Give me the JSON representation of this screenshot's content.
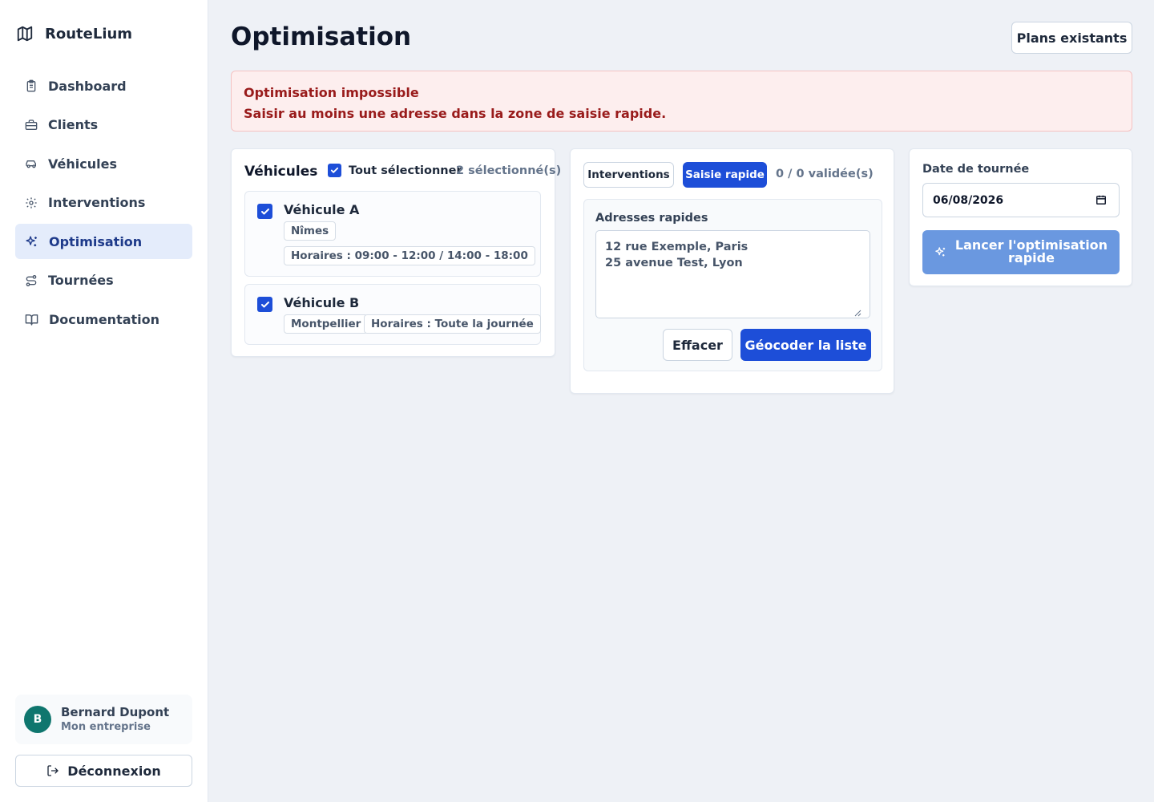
{
  "brand": {
    "name": "RouteLium",
    "icon": "map-icon"
  },
  "sidebar": {
    "items": [
      {
        "label": "Dashboard",
        "icon": "clipboard-icon",
        "active": false
      },
      {
        "label": "Clients",
        "icon": "briefcase-icon",
        "active": false
      },
      {
        "label": "Véhicules",
        "icon": "car-icon",
        "active": false
      },
      {
        "label": "Interventions",
        "icon": "gear-icon",
        "active": false
      },
      {
        "label": "Optimisation",
        "icon": "sparkles-icon",
        "active": true
      },
      {
        "label": "Tournées",
        "icon": "route-icon",
        "active": false
      },
      {
        "label": "Documentation",
        "icon": "book-icon",
        "active": false
      }
    ]
  },
  "user": {
    "initial": "B",
    "name": "Bernard Dupont",
    "company": "Mon entreprise"
  },
  "logout": {
    "label": "Déconnexion",
    "icon": "logout-icon"
  },
  "header": {
    "title": "Optimisation",
    "plans_button": "Plans existants"
  },
  "alert": {
    "title": "Optimisation impossible",
    "message": "Saisir au moins une adresse dans la zone de saisie rapide."
  },
  "vehicles": {
    "title": "Véhicules",
    "select_all_label": "Tout sélectionner",
    "select_all_checked": true,
    "selected_count": "2 sélectionné(s)",
    "items": [
      {
        "name": "Véhicule A",
        "checked": true,
        "tags": [
          "Nîmes",
          "Horaires : 09:00 - 12:00 / 14:00 - 18:00"
        ]
      },
      {
        "name": "Véhicule B",
        "checked": true,
        "tags": [
          "Montpellier",
          "Horaires : Toute la journée"
        ]
      }
    ]
  },
  "quick_entry": {
    "tabs": [
      {
        "label": "Interventions",
        "active": false
      },
      {
        "label": "Saisie rapide",
        "active": true
      }
    ],
    "validated_count": "0 / 0 validée(s)",
    "addresses_label": "Adresses rapides",
    "addresses_value": "12 rue Exemple, Paris\n25 avenue Test, Lyon",
    "clear_button": "Effacer",
    "geocode_button": "Géocoder la liste"
  },
  "tour": {
    "date_label": "Date de tournée",
    "date_value": "06/08/2026",
    "launch_button": "Lancer l'optimisation rapide"
  },
  "colors": {
    "primary": "#1d4ed8",
    "primary_disabled": "#6a98e0",
    "alert_bg": "#fdeeee",
    "alert_text": "#991b1b",
    "avatar": "#0f766e",
    "active_nav_bg": "#e4ecfb"
  }
}
